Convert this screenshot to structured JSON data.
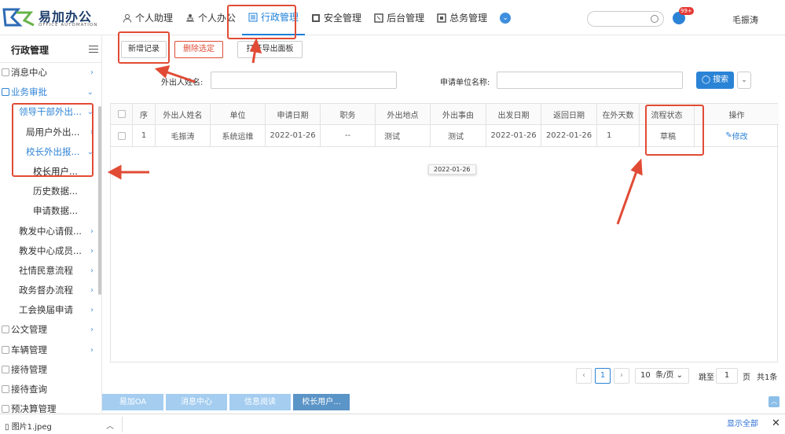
{
  "app": {
    "name": "易加办公",
    "subtitle": "OFFICE AUTOMATION"
  },
  "nav": {
    "items": [
      {
        "label": "个人助理",
        "icon": "person-icon"
      },
      {
        "label": "个人办公",
        "icon": "desk-icon"
      },
      {
        "label": "行政管理",
        "icon": "document-icon"
      },
      {
        "label": "安全管理",
        "icon": "shield-icon"
      },
      {
        "label": "后台管理",
        "icon": "settings-icon"
      },
      {
        "label": "总务管理",
        "icon": "box-icon"
      }
    ],
    "more": "⌄"
  },
  "header": {
    "badge": "99+",
    "user": "毛振涛"
  },
  "sidebar": {
    "title": "行政管理",
    "items": [
      {
        "label": "消息中心",
        "indent": 1
      },
      {
        "label": "业务审批",
        "indent": 1
      },
      {
        "label": "领导干部外出...",
        "indent": 2
      },
      {
        "label": "局用户外出...",
        "indent": 3
      },
      {
        "label": "校长外出报...",
        "indent": 3
      },
      {
        "label": "校长用户...",
        "indent": 4
      },
      {
        "label": "历史数据...",
        "indent": 4
      },
      {
        "label": "申请数据...",
        "indent": 4
      },
      {
        "label": "教发中心请假...",
        "indent": 2
      },
      {
        "label": "教发中心成员...",
        "indent": 2
      },
      {
        "label": "社情民意流程",
        "indent": 2
      },
      {
        "label": "政务督办流程",
        "indent": 2
      },
      {
        "label": "工会换届申请",
        "indent": 2
      },
      {
        "label": "公文管理",
        "indent": 1
      },
      {
        "label": "车辆管理",
        "indent": 1
      },
      {
        "label": "接待管理",
        "indent": 1
      },
      {
        "label": "接待查询",
        "indent": 1
      },
      {
        "label": "预决算管理",
        "indent": 1
      }
    ]
  },
  "toolbar": {
    "add": "新增记录",
    "delete": "删除选定",
    "export": "打开导出面板"
  },
  "filters": {
    "name_label": "外出人姓名:",
    "unit_label": "申请单位名称:",
    "search": "搜索",
    "dropdown": "⌄"
  },
  "table": {
    "headers": [
      "序",
      "外出人姓名",
      "单位",
      "申请日期",
      "职务",
      "外出地点",
      "外出事由",
      "出发日期",
      "返回日期",
      "在外天数",
      "流程状态",
      "操作"
    ],
    "rows": [
      [
        "1",
        "毛振涛",
        "系统运维",
        "2022-01-26",
        "--",
        "测试",
        "测试",
        "2022-01-26",
        "2022-01-26",
        "1",
        "草稿",
        "修改"
      ]
    ]
  },
  "tooltip": "2022-01-26",
  "pager": {
    "current": "1",
    "page_size": "10",
    "unit": "条/页",
    "jump_label": "跳至",
    "jump_value": "1",
    "page_word": "页",
    "total": "共1条"
  },
  "bottom_tabs": [
    "易加OA",
    "消息中心",
    "信息阅读",
    "校长用户..."
  ],
  "downloads": {
    "file": "图片1.jpeg",
    "show_all": "显示全部"
  }
}
